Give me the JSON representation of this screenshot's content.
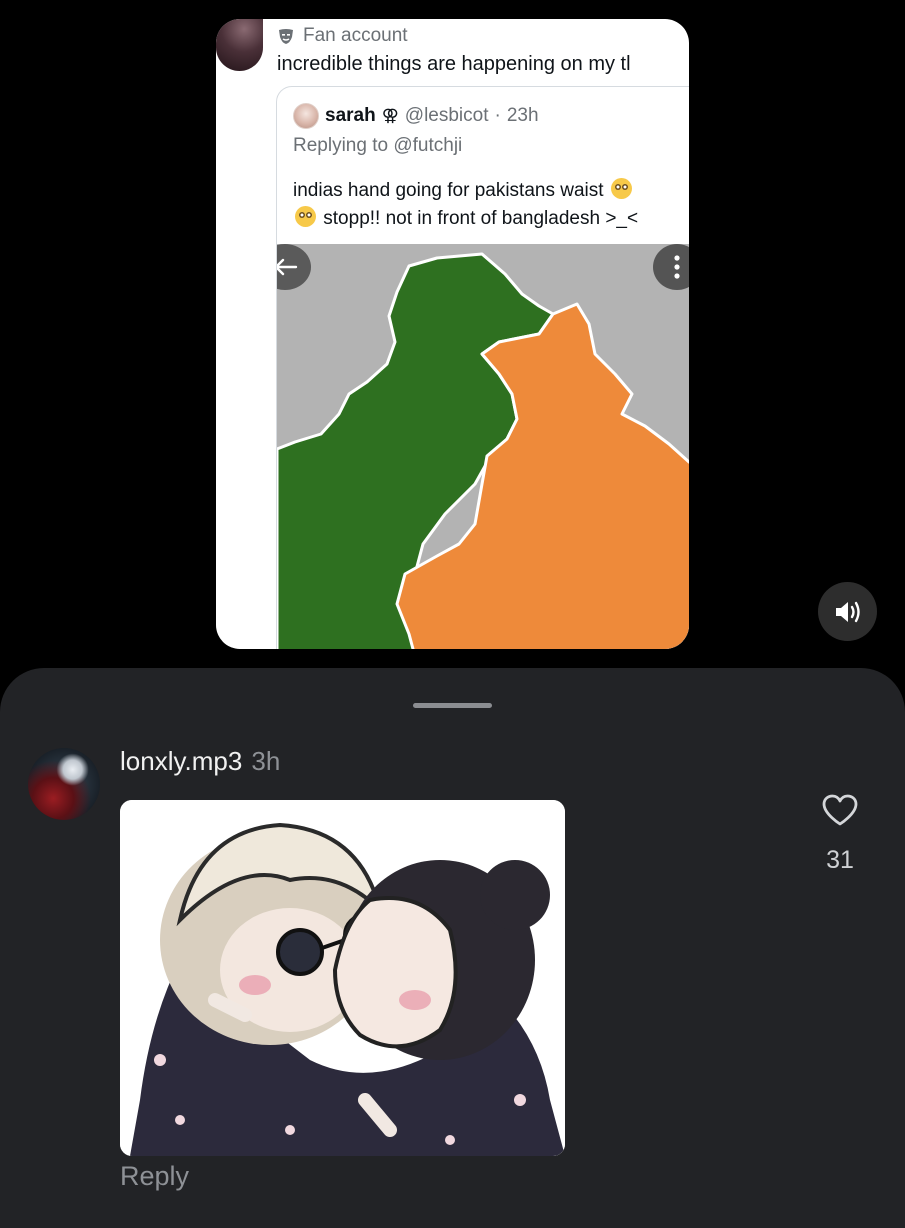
{
  "embedded_post": {
    "account_label": "Fan account",
    "account_icon": "mask-icon",
    "text": "incredible things are happening on my tl",
    "quote": {
      "name": "sarah",
      "name_symbol": "⚢",
      "handle": "@lesbicot",
      "separator": "·",
      "time": "23h",
      "replying_to_prefix": "Replying to",
      "replying_to_handle": "@futchji",
      "text_line1": "indias hand going for pakistans waist",
      "text_line2": "stopp!! not in front of bangladesh >_<",
      "emoji": "flushed-face-emoji",
      "media_controls": {
        "back_icon": "arrow-left-icon",
        "more_icon": "more-vertical-icon"
      },
      "map_colors": {
        "background": "#b3b3b3",
        "pakistan": "#2e7020",
        "india": "#ee8a3a",
        "border": "#ffffff"
      }
    }
  },
  "mute_button": {
    "icon": "speaker-icon"
  },
  "comment_sheet": {
    "comment": {
      "username": "lonxly.mp3",
      "time": "3h",
      "image_icon": "sticker-image",
      "reply_label": "Reply",
      "like_icon": "heart-icon",
      "like_count": "31"
    }
  },
  "colors": {
    "page_bg": "#000000",
    "sheet_bg": "#222326",
    "secondary_text": "#8e9196"
  }
}
